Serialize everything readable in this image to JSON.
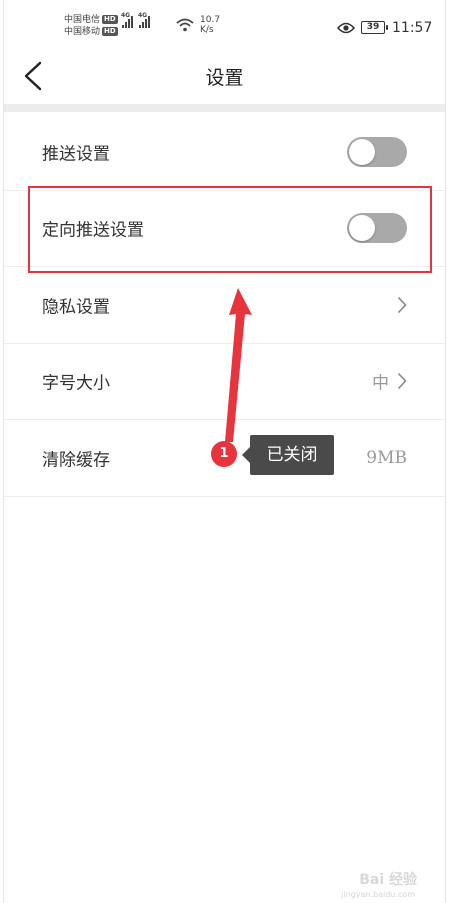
{
  "status_bar": {
    "carrier1": "中国电信",
    "carrier2": "中国移动",
    "hd_badge": "HD",
    "network1": "4G",
    "network2": "4G",
    "speed_value": "10.7",
    "speed_unit": "K/s",
    "battery": "39",
    "time": "11:57"
  },
  "nav": {
    "title": "设置"
  },
  "settings": [
    {
      "label": "推送设置",
      "type": "toggle",
      "on": false
    },
    {
      "label": "定向推送设置",
      "type": "toggle",
      "on": false
    },
    {
      "label": "隐私设置",
      "type": "link",
      "value": ""
    },
    {
      "label": "字号大小",
      "type": "link",
      "value": "中"
    },
    {
      "label": "清除缓存",
      "type": "value",
      "value": "9MB"
    }
  ],
  "annotation": {
    "step": "1",
    "tooltip": "已关闭",
    "color": "#e8343c"
  },
  "watermark": {
    "text": "Bai 经验",
    "sub": "jingyan.baidu.com"
  }
}
